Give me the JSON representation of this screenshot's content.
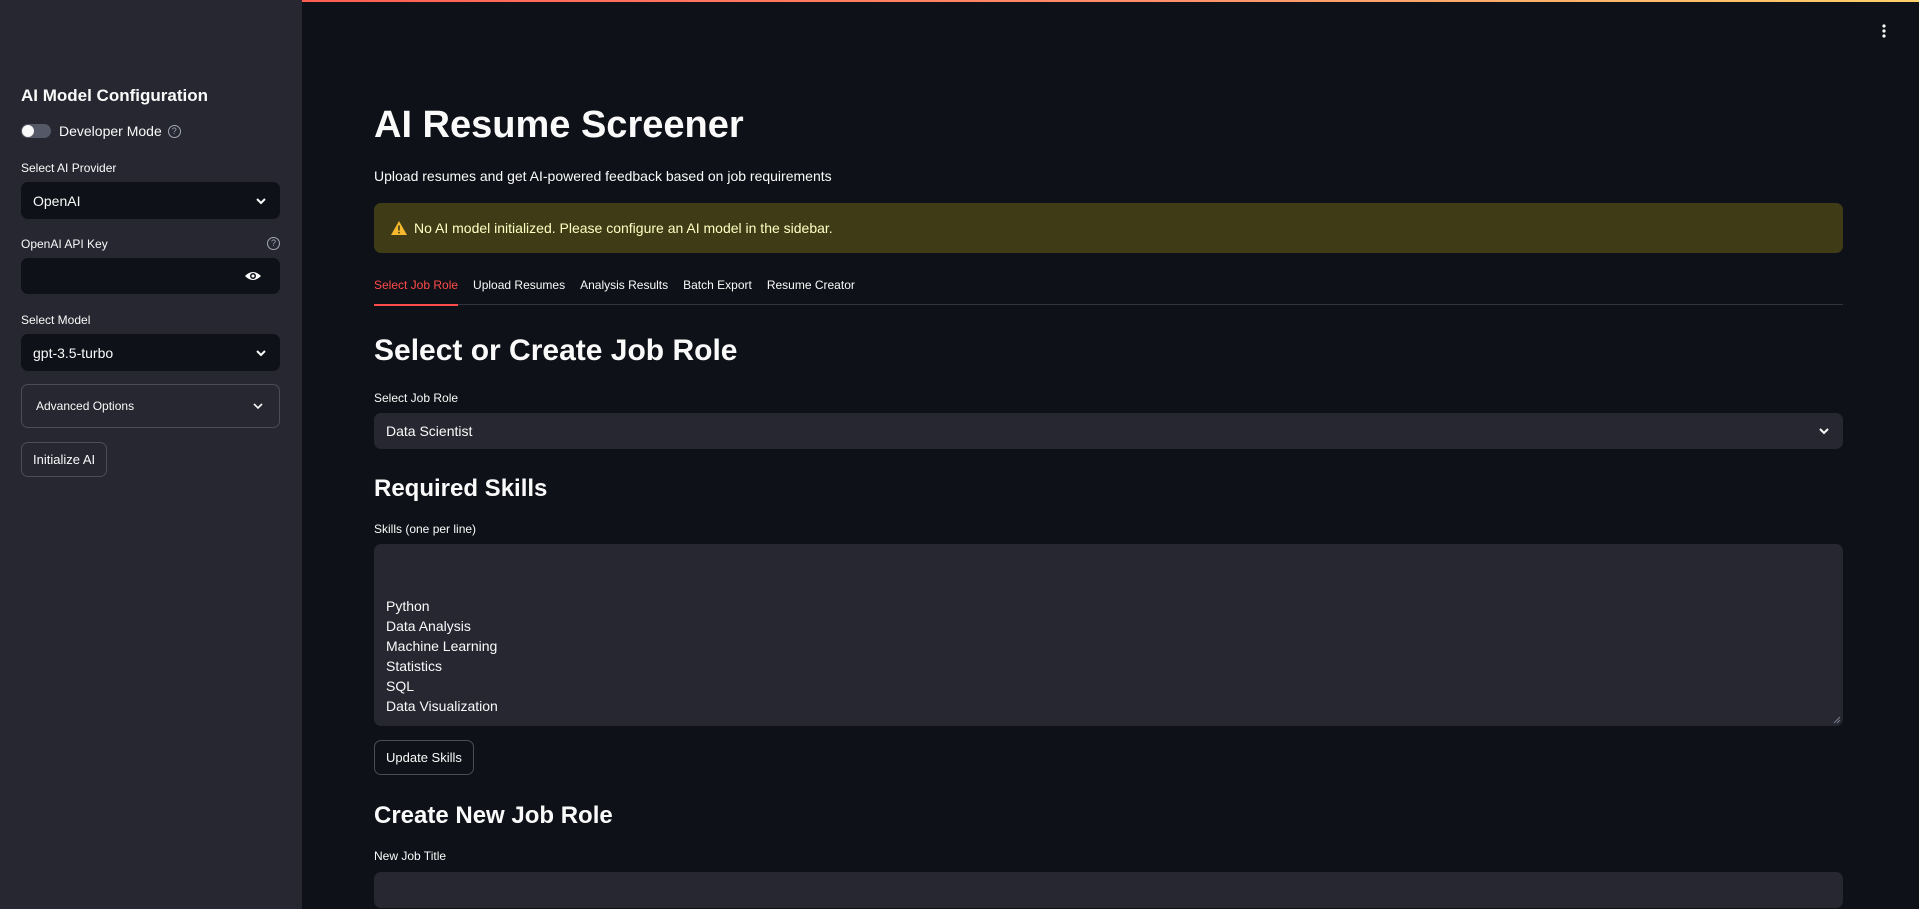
{
  "sidebar": {
    "title": "AI Model Configuration",
    "developer_mode_label": "Developer Mode",
    "provider_label": "Select AI Provider",
    "provider_value": "OpenAI",
    "api_key_label": "OpenAI API Key",
    "api_key_value": "",
    "model_label": "Select Model",
    "model_value": "gpt-3.5-turbo",
    "advanced_options_label": "Advanced Options",
    "initialize_button": "Initialize AI"
  },
  "main": {
    "title": "AI Resume Screener",
    "subtitle": "Upload resumes and get AI-powered feedback based on job requirements",
    "alert": "No AI model initialized. Please configure an AI model in the sidebar.",
    "tabs": [
      {
        "label": "Select Job Role",
        "active": true
      },
      {
        "label": "Upload Resumes",
        "active": false
      },
      {
        "label": "Analysis Results",
        "active": false
      },
      {
        "label": "Batch Export",
        "active": false
      },
      {
        "label": "Resume Creator",
        "active": false
      }
    ],
    "section_title": "Select or Create Job Role",
    "job_role_label": "Select Job Role",
    "job_role_value": "Data Scientist",
    "skills_title": "Required Skills",
    "skills_label": "Skills (one per line)",
    "skills": [
      "Python",
      "Data Analysis",
      "Machine Learning",
      "Statistics",
      "SQL",
      "Data Visualization"
    ],
    "update_skills_button": "Update Skills",
    "create_title": "Create New Job Role",
    "new_job_title_label": "New Job Title",
    "new_job_title_value": ""
  },
  "colors": {
    "accent": "#ff4b4b",
    "background": "#0e1117",
    "sidebar": "#262730",
    "warning_bg": "#3e3b16",
    "warning_text": "#ffffc2"
  },
  "icons": [
    "help-icon",
    "chevron-down-icon",
    "eye-icon",
    "warning-icon",
    "more-vertical-icon"
  ]
}
